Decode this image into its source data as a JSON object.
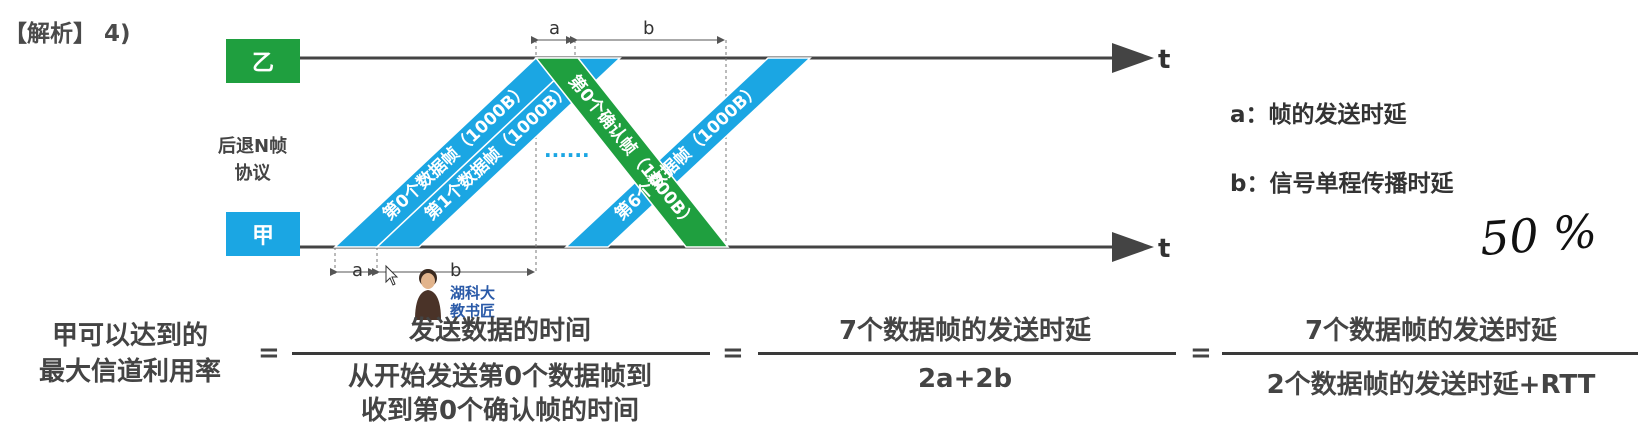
{
  "title": "【解析】 4)",
  "nodes": {
    "receiver": "乙",
    "sender": "甲"
  },
  "protocol": {
    "line1": "后退N帧",
    "line2": "协议"
  },
  "axis_label": "t",
  "intervals": {
    "a": "a",
    "b": "b"
  },
  "frames": {
    "f0": "第0个数据帧（1000B）",
    "f1": "第1个数据帧（1000B）",
    "f6": "第6个数据帧（1000B）",
    "ack": "第0个确认帧（1000B）",
    "dots": "······"
  },
  "legend": {
    "a": "a：帧的发送时延",
    "b": "b：信号单程传播时延"
  },
  "handwritten": "50 %",
  "instructor_badge": {
    "line1": "湖科大",
    "line2": "教书匠"
  },
  "formula": {
    "lhs_line1": "甲可以达到的",
    "lhs_line2": "最大信道利用率",
    "eq": "=",
    "frac1_num": "发送数据的时间",
    "frac1_den1": "从开始发送第0个数据帧到",
    "frac1_den2": "收到第0个确认帧的时间",
    "frac2_num": "7个数据帧的发送时延",
    "frac2_den": "2a+2b",
    "frac3_num": "7个数据帧的发送时延",
    "frac3_den": "2个数据帧的发送时延+RTT"
  },
  "colors": {
    "green": "#1f9f3f",
    "blue": "#1ba6e3",
    "axis": "#444444"
  }
}
